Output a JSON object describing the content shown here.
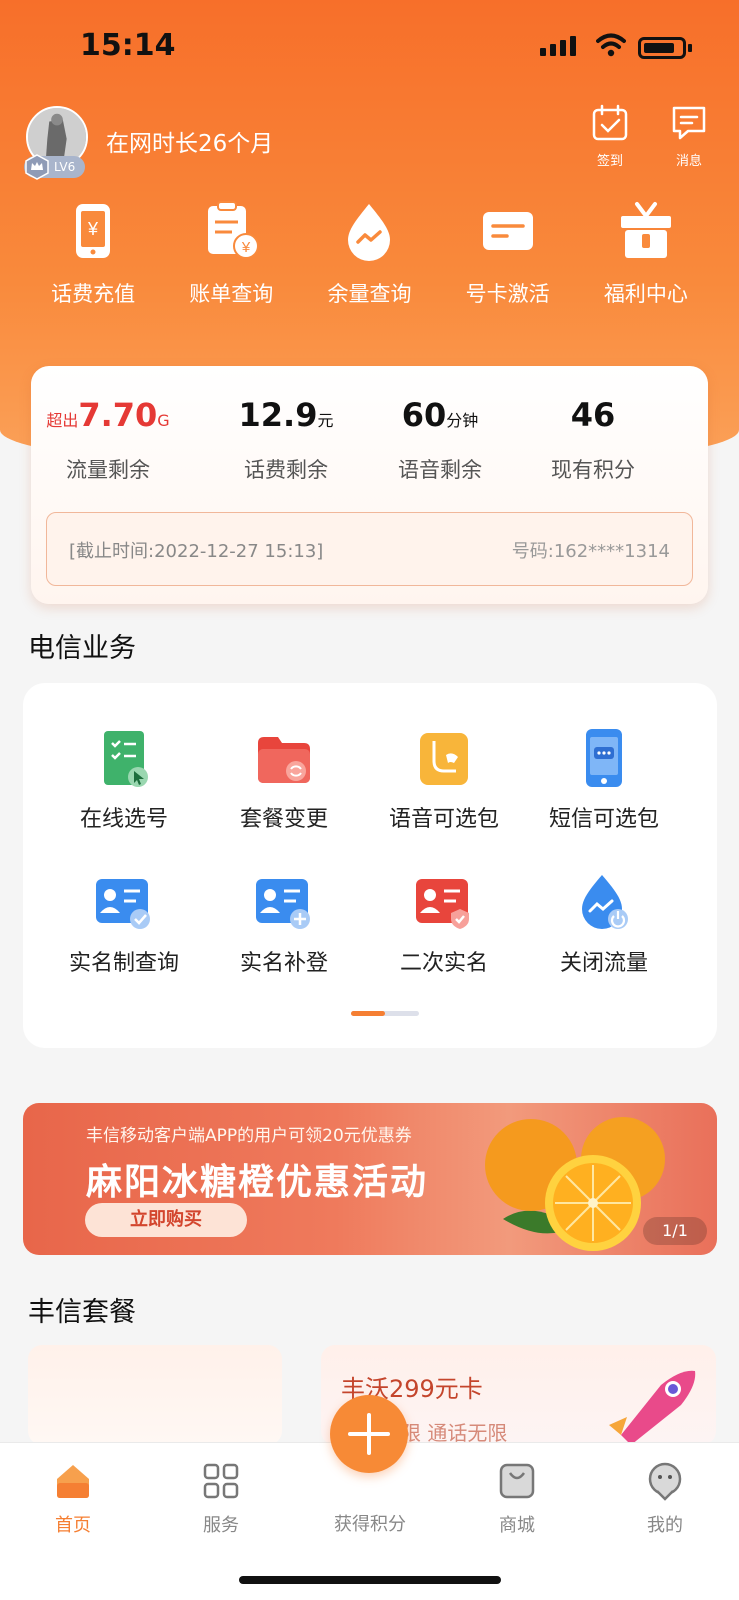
{
  "status_bar": {
    "time": "15:14"
  },
  "profile": {
    "level": "LV6",
    "tenure": "在网时长26个月"
  },
  "top_actions": [
    {
      "label": "签到",
      "icon": "checkin-calendar-icon"
    },
    {
      "label": "消息",
      "icon": "message-icon"
    }
  ],
  "quick_actions": [
    {
      "label": "话费充值",
      "icon": "phone-recharge-icon"
    },
    {
      "label": "账单查询",
      "icon": "bill-query-icon"
    },
    {
      "label": "余量查询",
      "icon": "balance-query-icon"
    },
    {
      "label": "号卡激活",
      "icon": "card-activate-icon"
    },
    {
      "label": "福利中心",
      "icon": "gift-icon"
    }
  ],
  "usage": {
    "data": {
      "prefix": "超出",
      "value": "7.70",
      "unit": "G",
      "label": "流量剩余"
    },
    "fee": {
      "value": "12.9",
      "unit": "元",
      "label": "话费剩余"
    },
    "voice": {
      "value": "60",
      "unit": "分钟",
      "label": "语音剩余"
    },
    "points": {
      "value": "46",
      "label": "现有积分"
    },
    "as_of": "[截止时间:2022-12-27 15:13]",
    "number": "号码:162****1314"
  },
  "services": {
    "title": "电信业务",
    "items": [
      {
        "label": "在线选号",
        "icon": "select-number-icon"
      },
      {
        "label": "套餐变更",
        "icon": "plan-change-icon"
      },
      {
        "label": "语音可选包",
        "icon": "voice-package-icon"
      },
      {
        "label": "短信可选包",
        "icon": "sms-package-icon"
      },
      {
        "label": "实名制查询",
        "icon": "realname-query-icon"
      },
      {
        "label": "实名补登",
        "icon": "realname-register-icon"
      },
      {
        "label": "二次实名",
        "icon": "realname-second-icon"
      },
      {
        "label": "关闭流量",
        "icon": "data-off-icon"
      }
    ]
  },
  "banner": {
    "subtitle": "丰信移动客户端APP的用户可领20元优惠券",
    "title": "麻阳冰糖橙优惠活动",
    "button": "立即购买",
    "counter": "1/1"
  },
  "plans": {
    "title": "丰信套餐",
    "featured_name": "丰沃299元卡",
    "featured_desc": "流量无限 通话无限"
  },
  "tabbar": {
    "items": [
      {
        "label": "首页",
        "icon": "home-icon",
        "active": true
      },
      {
        "label": "服务",
        "icon": "services-grid-icon"
      },
      {
        "label": "获得积分",
        "icon": "plus-icon"
      },
      {
        "label": "商城",
        "icon": "shop-bag-icon"
      },
      {
        "label": "我的",
        "icon": "profile-icon"
      }
    ]
  },
  "colors": {
    "accent": "#f57f33",
    "hero": "#f76f2a",
    "alert": "#e53935"
  }
}
